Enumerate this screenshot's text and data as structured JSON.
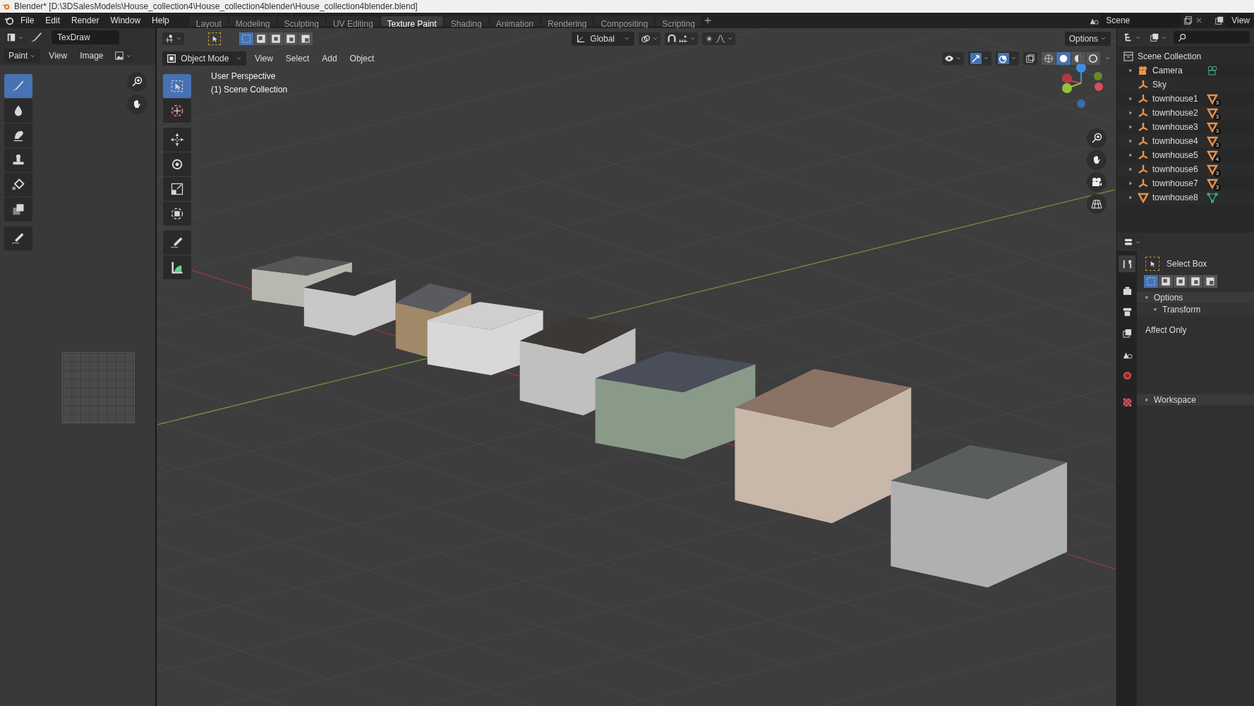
{
  "title_bar": {
    "title": "Blender* [D:\\3DSalesModels\\House_collection4\\House_collection4blender\\House_collection4blender.blend]"
  },
  "menu": [
    "File",
    "Edit",
    "Render",
    "Window",
    "Help"
  ],
  "workspaces": [
    {
      "label": "Layout",
      "selected": false
    },
    {
      "label": "Modeling",
      "selected": false
    },
    {
      "label": "Sculpting",
      "selected": false
    },
    {
      "label": "UV Editing",
      "selected": false
    },
    {
      "label": "Texture Paint",
      "selected": true
    },
    {
      "label": "Shading",
      "selected": false
    },
    {
      "label": "Animation",
      "selected": false
    },
    {
      "label": "Rendering",
      "selected": false
    },
    {
      "label": "Compositing",
      "selected": false
    },
    {
      "label": "Scripting",
      "selected": false
    }
  ],
  "scene": {
    "value": "Scene"
  },
  "view_layer": {
    "value": "View"
  },
  "image_editor": {
    "brush": "TexDraw",
    "menus": [
      "Paint",
      "View",
      "Image"
    ],
    "tools": [
      {
        "kind": "draw",
        "selected": true
      },
      {
        "kind": "soften",
        "selected": false
      },
      {
        "kind": "smear",
        "selected": false
      },
      {
        "kind": "clone",
        "selected": false
      },
      {
        "kind": "fill",
        "selected": false
      },
      {
        "kind": "mask",
        "selected": false
      },
      {
        "kind": "annotate",
        "selected": false
      }
    ]
  },
  "viewport": {
    "mode": "Object Mode",
    "menus": [
      "View",
      "Select",
      "Add",
      "Object"
    ],
    "orientation": "Global",
    "options": "Options",
    "select_modes": [
      {
        "selected": true
      },
      {
        "selected": false
      },
      {
        "selected": false
      },
      {
        "selected": false
      },
      {
        "selected": false
      }
    ],
    "overlay": [
      "User Perspective",
      "(1) Scene Collection"
    ],
    "tools": [
      {
        "kind": "select",
        "selected": true
      },
      {
        "kind": "cursor",
        "selected": false
      },
      {
        "kind": "move",
        "selected": false
      },
      {
        "kind": "rotate",
        "selected": false
      },
      {
        "kind": "scale",
        "selected": false
      },
      {
        "kind": "transform",
        "selected": false
      },
      {
        "kind": "annotate",
        "selected": false
      },
      {
        "kind": "measure",
        "selected": false
      }
    ],
    "shading": [
      {
        "selected": false
      },
      {
        "selected": true
      },
      {
        "selected": false
      },
      {
        "selected": false
      }
    ]
  },
  "outliner": {
    "root": "Scene Collection",
    "items": [
      {
        "name": "Camera",
        "kind": "camera",
        "expandable": true,
        "data": {
          "kind": "camera"
        }
      },
      {
        "name": "Sky",
        "kind": "empty",
        "expandable": false
      },
      {
        "name": "townhouse1",
        "kind": "empty",
        "expandable": true,
        "data": {
          "kind": "meshes",
          "count": "3"
        }
      },
      {
        "name": "townhouse2",
        "kind": "empty",
        "expandable": true,
        "data": {
          "kind": "meshes",
          "count": "3"
        }
      },
      {
        "name": "townhouse3",
        "kind": "empty",
        "expandable": true,
        "data": {
          "kind": "meshes",
          "count": "3"
        }
      },
      {
        "name": "townhouse4",
        "kind": "empty",
        "expandable": true,
        "data": {
          "kind": "meshes",
          "count": "3"
        }
      },
      {
        "name": "townhouse5",
        "kind": "empty",
        "expandable": true,
        "data": {
          "kind": "meshes",
          "count": "4"
        }
      },
      {
        "name": "townhouse6",
        "kind": "empty",
        "expandable": true,
        "data": {
          "kind": "meshes",
          "count": "3"
        }
      },
      {
        "name": "townhouse7",
        "kind": "empty",
        "expandable": true,
        "data": {
          "kind": "meshes",
          "count": "3"
        }
      },
      {
        "name": "townhouse8",
        "kind": "mesh",
        "expandable": true,
        "data": {
          "kind": "mesh"
        }
      }
    ]
  },
  "properties": {
    "tabs": [
      {
        "kind": "tool",
        "selected": true
      },
      {
        "kind": "render",
        "selected": false
      },
      {
        "kind": "output",
        "selected": false
      },
      {
        "kind": "view_layer",
        "selected": false
      },
      {
        "kind": "scene",
        "selected": false
      },
      {
        "kind": "world",
        "selected": false
      },
      {
        "kind": "texture",
        "selected": false
      }
    ],
    "tool": "Select Box",
    "select_modes": [
      {
        "selected": true
      },
      {
        "selected": false
      },
      {
        "selected": false
      },
      {
        "selected": false
      },
      {
        "selected": false
      }
    ],
    "panels": [
      {
        "label": "Options",
        "expanded": true,
        "children": [
          {
            "label": "Transform",
            "expanded": true
          }
        ]
      }
    ],
    "affect_label": "Affect Only",
    "workspace": {
      "label": "Workspace",
      "expanded": false
    }
  }
}
